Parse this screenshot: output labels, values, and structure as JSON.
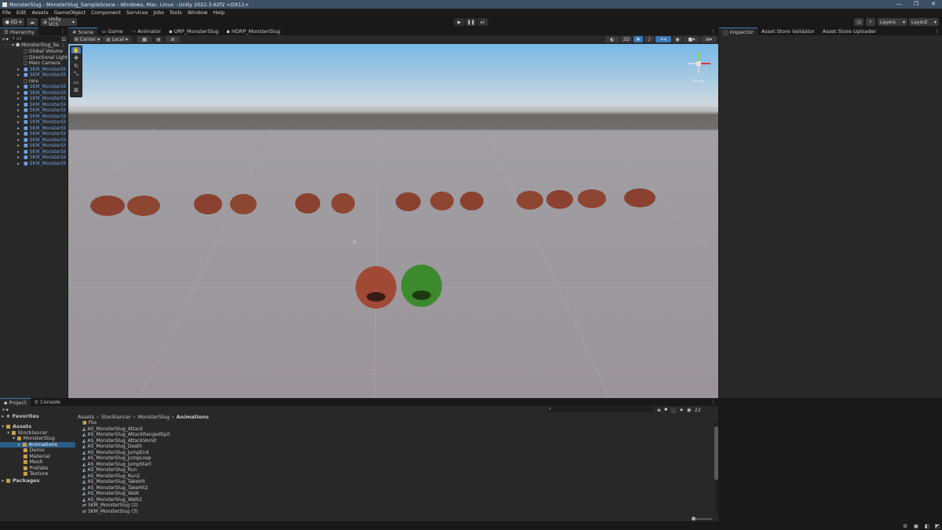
{
  "window": {
    "title": "MonsterSlug - MonsterSlug_SampleScene - Windows, Mac, Linux - Unity 2022.3.62f2 <DX11>",
    "minimize": "—",
    "maximize": "❐",
    "close": "✕"
  },
  "menu": [
    "File",
    "Edit",
    "Assets",
    "GameObject",
    "Component",
    "Services",
    "Jobs",
    "Tools",
    "Window",
    "Help"
  ],
  "toolbar": {
    "account": "KD",
    "vcs": "Unity VCS",
    "layers": "Layers",
    "layout": "Layout"
  },
  "hierarchy": {
    "tab": "Hierarchy",
    "search_placeholder": "All",
    "scene_name": "MonsterSlug_Sa",
    "items": [
      {
        "label": "Global Volume",
        "blue": false
      },
      {
        "label": "Directional Light",
        "blue": false
      },
      {
        "label": "Main Camera",
        "blue": false
      },
      {
        "label": "SKM_MonsterSl",
        "blue": true
      },
      {
        "label": "SKM_MonsterSl",
        "blue": true
      },
      {
        "label": "rere",
        "blue": false
      },
      {
        "label": "SKM_MonsterSl",
        "blue": true
      },
      {
        "label": "SKM_MonsterSl",
        "blue": true
      },
      {
        "label": "SKM_MonsterSl",
        "blue": true
      },
      {
        "label": "SKM_MonsterSl",
        "blue": true
      },
      {
        "label": "SKM_MonsterSl",
        "blue": true
      },
      {
        "label": "SKM_MonsterSl",
        "blue": true
      },
      {
        "label": "SKM_MonsterSl",
        "blue": true
      },
      {
        "label": "SKM_MonsterSl",
        "blue": true
      },
      {
        "label": "SKM_MonsterSl",
        "blue": true
      },
      {
        "label": "SKM_MonsterSl",
        "blue": true
      },
      {
        "label": "SKM_MonsterSl",
        "blue": true
      },
      {
        "label": "SKM_MonsterSl",
        "blue": true
      },
      {
        "label": "SKM_MonsterSl",
        "blue": true
      },
      {
        "label": "SKM_MonsterSl",
        "blue": true
      }
    ]
  },
  "scene": {
    "tabs": [
      "Scene",
      "Game",
      "Animator",
      "URP_MonsterSlug",
      "HDRP_MonsterSlug"
    ],
    "pivot": "Center",
    "space": "Local",
    "mode_2d": "2D",
    "gizmo_label": "Persp"
  },
  "inspector": {
    "tabs": [
      "Inspector",
      "Asset Store Validator",
      "Asset Store Uploader"
    ]
  },
  "project": {
    "tabs": [
      "Project",
      "Console"
    ],
    "favorites": "Favorites",
    "tree": [
      {
        "label": "Assets",
        "depth": 0,
        "bold": true
      },
      {
        "label": "Stocklancer",
        "depth": 1
      },
      {
        "label": "MonsterSlug",
        "depth": 2
      },
      {
        "label": "Animations",
        "depth": 3,
        "selected": true
      },
      {
        "label": "Demo",
        "depth": 3
      },
      {
        "label": "Material",
        "depth": 3
      },
      {
        "label": "Mesh",
        "depth": 3
      },
      {
        "label": "Prefabs",
        "depth": 3
      },
      {
        "label": "Texture",
        "depth": 3
      }
    ],
    "packages": "Packages",
    "breadcrumb": [
      "Assets",
      "Stocklancer",
      "MonsterSlug",
      "Animations"
    ],
    "hidden_count": "22",
    "files": [
      {
        "label": "Fbx",
        "type": "folder"
      },
      {
        "label": "AS_MonsterSlug_Attack",
        "type": "anim"
      },
      {
        "label": "AS_MonsterSlug_AttackRangedSpit",
        "type": "anim"
      },
      {
        "label": "AS_MonsterSlug_AttackVomit",
        "type": "anim"
      },
      {
        "label": "AS_MonsterSlug_Death",
        "type": "anim"
      },
      {
        "label": "AS_MonsterSlug_JumpEnd",
        "type": "anim"
      },
      {
        "label": "AS_MonsterSlug_JumpLoop",
        "type": "anim"
      },
      {
        "label": "AS_MonsterSlug_JumpStart",
        "type": "anim"
      },
      {
        "label": "AS_MonsterSlug_Run",
        "type": "anim"
      },
      {
        "label": "AS_MonsterSlug_Run2",
        "type": "anim"
      },
      {
        "label": "AS_MonsterSlug_TakeHit",
        "type": "anim"
      },
      {
        "label": "AS_MonsterSlug_TakeHit2",
        "type": "anim"
      },
      {
        "label": "AS_MonsterSlug_Walk",
        "type": "anim"
      },
      {
        "label": "AS_MonsterSlug_Walk2",
        "type": "anim"
      },
      {
        "label": "SKM_MonsterSlug (2)",
        "type": "ctrl"
      },
      {
        "label": "SKM_MonsterSlug (3)",
        "type": "ctrl"
      }
    ]
  },
  "colors": {
    "accent": "#3a79bb",
    "prefab_blue": "#6fa3e0",
    "selected_row": "#2c5d87"
  }
}
